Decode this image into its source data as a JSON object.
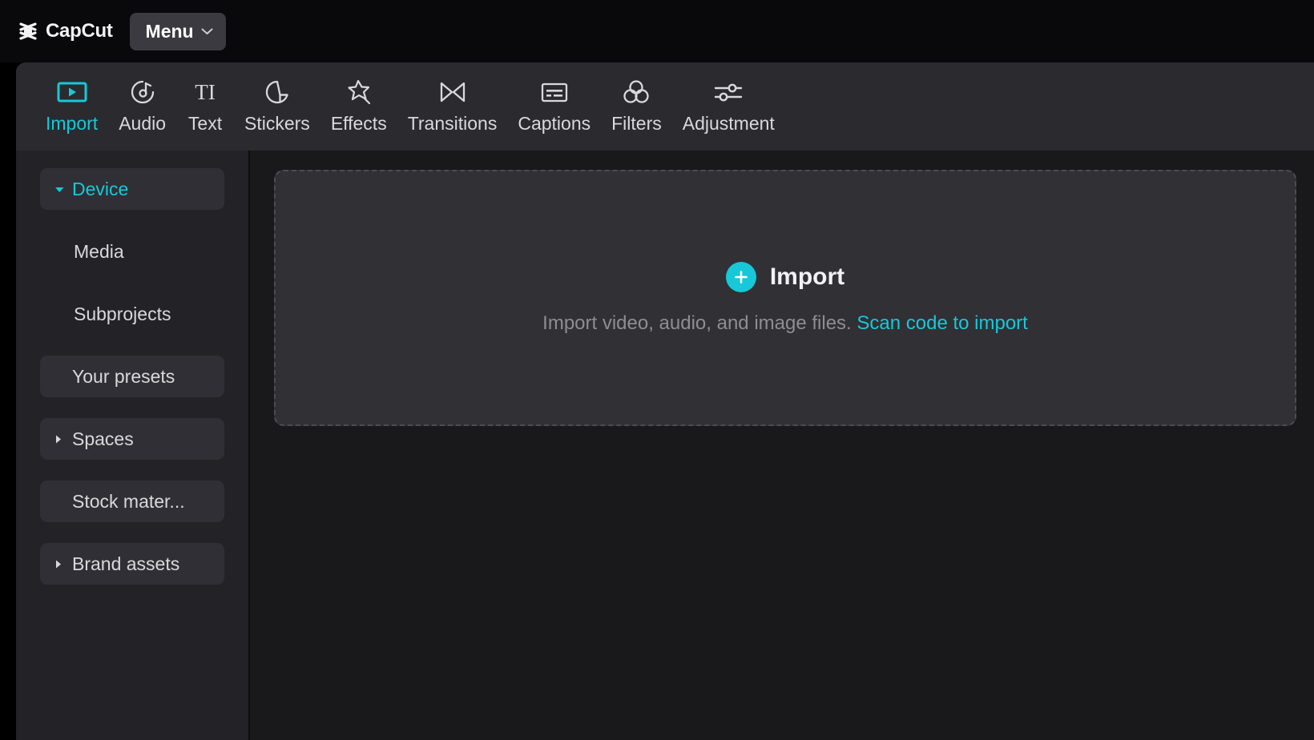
{
  "app": {
    "brand_name": "CapCut",
    "brand_icon": "capcut-logo-icon",
    "menu_label": "Menu",
    "menu_chevron_icon": "chevron-down-icon"
  },
  "colors": {
    "accent": "#17c8d8",
    "titlebar_bg": "#09090b",
    "toolbar_bg": "#2a2a2f",
    "sidebar_bg": "#232327",
    "content_bg": "#19191b",
    "dropzone_bg": "#303035",
    "text_primary": "#d9d9dd",
    "text_muted": "#8d8d93"
  },
  "toolbar": {
    "active_tab": "Import",
    "tabs": [
      {
        "label": "Import",
        "icon": "import-video-icon",
        "active": true
      },
      {
        "label": "Audio",
        "icon": "audio-note-icon",
        "active": false
      },
      {
        "label": "Text",
        "icon": "text-ti-icon",
        "active": false
      },
      {
        "label": "Stickers",
        "icon": "sticker-icon",
        "active": false
      },
      {
        "label": "Effects",
        "icon": "effects-star-icon",
        "active": false
      },
      {
        "label": "Transitions",
        "icon": "transitions-bowtie-icon",
        "active": false
      },
      {
        "label": "Captions",
        "icon": "captions-icon",
        "active": false
      },
      {
        "label": "Filters",
        "icon": "filters-circles-icon",
        "active": false
      },
      {
        "label": "Adjustment",
        "icon": "adjustment-sliders-icon",
        "active": false
      }
    ]
  },
  "sidebar": {
    "items": [
      {
        "label": "Device",
        "style": "selected",
        "expander": "down",
        "icon": "triangle-down-icon"
      },
      {
        "label": "Media",
        "style": "sub",
        "expander": "none",
        "icon": ""
      },
      {
        "label": "Subprojects",
        "style": "sub",
        "expander": "none",
        "icon": ""
      },
      {
        "label": "Your presets",
        "style": "filled",
        "expander": "none",
        "icon": ""
      },
      {
        "label": "Spaces",
        "style": "filled",
        "expander": "right",
        "icon": "triangle-right-icon"
      },
      {
        "label": "Stock mater...",
        "style": "filled",
        "expander": "none",
        "icon": ""
      },
      {
        "label": "Brand assets",
        "style": "filled",
        "expander": "right",
        "icon": "triangle-right-icon"
      }
    ]
  },
  "dropzone": {
    "plus_icon": "plus-circle-icon",
    "title": "Import",
    "description": "Import video, audio, and image files.",
    "link_label": "Scan code to import"
  }
}
